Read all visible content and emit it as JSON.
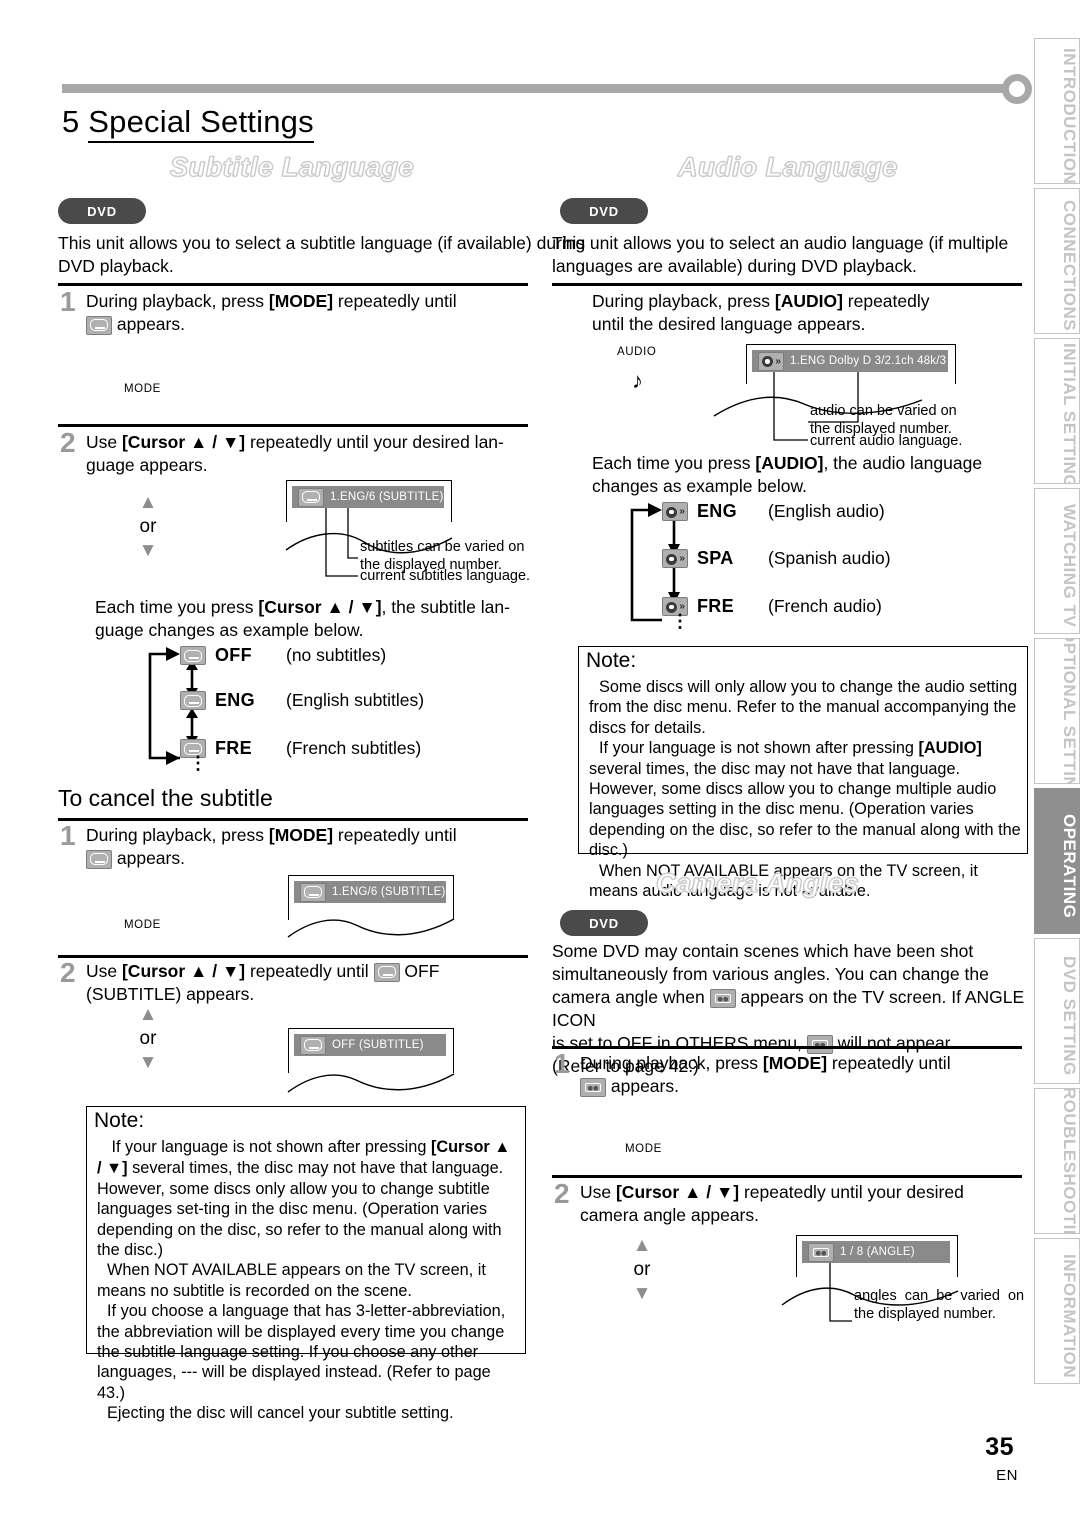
{
  "chapter": {
    "number": "5",
    "title": "Special Settings"
  },
  "sidebar": {
    "tabs": [
      {
        "label": "INTRODUCTION",
        "active": false
      },
      {
        "label": "CONNECTIONS",
        "active": false
      },
      {
        "label": "INITIAL SETTING",
        "active": false
      },
      {
        "label": "WATCHING TV",
        "active": false
      },
      {
        "label": "OPTIONAL SETTING",
        "active": false
      },
      {
        "label": "OPERATING",
        "active": true
      },
      {
        "label": "DVD SETTING",
        "active": false
      },
      {
        "label": "TROUBLESHOOTING",
        "active": false
      },
      {
        "label": "INFORMATION",
        "active": false
      }
    ]
  },
  "subtitle_section": {
    "banner": "Subtitle Language",
    "badge": "DVD",
    "intro": "This unit allows you to select a subtitle language (if available) during DVD playback.",
    "step1": {
      "number": "1",
      "text_before": "During playback, press ",
      "key": "[MODE]",
      "text_after": " repeatedly until",
      "line2": " appears.",
      "mode_label": "MODE"
    },
    "step2": {
      "number": "2",
      "text_before": "Use ",
      "key": "[Cursor ▲ / ▼]",
      "text_after": " repeatedly until your desired lan-",
      "line2": "guage appears.",
      "or_up": "▲",
      "or": "or",
      "or_down": "▼"
    },
    "osd": {
      "icon": "subtitle-icon",
      "text": "1.ENG/6  (SUBTITLE)",
      "callout_top": "subtitles can be varied on\nthe displayed number.",
      "callout_bottom": "current subtitles language."
    },
    "each_time": {
      "text_before": "Each time you press ",
      "key": "[Cursor ▲ / ▼]",
      "text_after": ", the subtitle lan-",
      "line2": "guage changes as example below."
    },
    "cycle": [
      {
        "code": "OFF",
        "desc": "(no subtitles)"
      },
      {
        "code": "ENG",
        "desc": "(English subtitles)"
      },
      {
        "code": "FRE",
        "desc": "(French subtitles)"
      }
    ]
  },
  "cancel_section": {
    "heading": "To cancel the subtitle",
    "step1": {
      "number": "1",
      "text_before": "During playback, press ",
      "key": "[MODE]",
      "text_after": " repeatedly until",
      "line2": " appears.",
      "mode_label": "MODE"
    },
    "step1_osd": {
      "text": "1.ENG/6  (SUBTITLE)"
    },
    "step2": {
      "number": "2",
      "text_before": "Use ",
      "key": "[Cursor ▲ / ▼]",
      "text_mid": " repeatedly until ",
      "text_after": " OFF",
      "line2": "(SUBTITLE)  appears.",
      "or_up": "▲",
      "or": "or",
      "or_down": "▼"
    },
    "step2_osd": {
      "text": "OFF  (SUBTITLE)"
    },
    "note": {
      "title": "Note:",
      "items": [
        "If your language is not shown after pressing [Cursor ▲ / ▼] several times, the disc may not have that language. However, some discs only allow you to change subtitle languages set-ting in the disc menu. (Operation varies depending on the disc, so refer to the manual along with the disc.)",
        "When  NOT AVAILABLE  appears on the TV screen, it means no subtitle is recorded on the scene.",
        "If you choose a language that has 3-letter-abbreviation, the abbreviation will be displayed every time you change the subtitle language setting. If you choose any other languages, ---  will be displayed instead. (Refer to page 43.)",
        "Ejecting the disc will cancel your subtitle setting."
      ]
    }
  },
  "audio_section": {
    "banner": "Audio Language",
    "badge": "DVD",
    "intro": "This unit allows you to select an audio language (if multiple languages are available) during DVD playback.",
    "step1": {
      "text_before": "During playback, press ",
      "key": "[AUDIO]",
      "text_after": " repeatedly",
      "line2": "until the desired language appears.",
      "audio_label": "AUDIO",
      "note_glyph": "♪"
    },
    "osd": {
      "icon": "audio-icon",
      "text": "1.ENG   Dolby D  3/2.1ch  48k/3",
      "callout_top": "audio can be varied on\nthe displayed number.",
      "callout_bottom": "current audio language."
    },
    "each_time": {
      "text_before": "Each time you press ",
      "key": "[AUDIO]",
      "text_after": ", the audio language",
      "line2": "changes as example below."
    },
    "cycle": [
      {
        "code": "ENG",
        "desc": "(English audio)"
      },
      {
        "code": "SPA",
        "desc": "(Spanish audio)"
      },
      {
        "code": "FRE",
        "desc": "(French audio)"
      }
    ],
    "note": {
      "title": "Note:",
      "items": [
        "Some discs will only allow you to change the audio setting from the disc menu. Refer to the manual accompanying the discs for details.",
        "If your language is not shown after pressing [AUDIO] several times, the disc may not have that language. However, some discs allow you to change multiple audio languages setting in the disc menu. (Operation varies depending on the disc, so refer to the manual along with the disc.)",
        "When  NOT AVAILABLE  appears on the TV screen, it means audio language is not available."
      ]
    }
  },
  "angles_section": {
    "banner": "Camera Angles",
    "badge": "DVD",
    "intro_line1": "Some DVD may contain scenes which have been shot",
    "intro_line2": "simultaneously from various angles. You can change the",
    "intro_line3": "camera angle when      appears on the TV screen. If  ANGLE ICON",
    "intro_line4": "is set to  OFF  in  OTHERS  menu,      will not appear.",
    "intro_line5": "(Refer to page 42.)",
    "step1": {
      "number": "1",
      "text_before": "During playback, press ",
      "key": "[MODE]",
      "text_after": " repeatedly until",
      "line2": " appears.",
      "mode_label": "MODE"
    },
    "step2": {
      "number": "2",
      "text_before": "Use ",
      "key": "[Cursor ▲ / ▼]",
      "text_after": " repeatedly until your desired",
      "line2": "camera angle appears.",
      "or_up": "▲",
      "or": "or",
      "or_down": "▼"
    },
    "osd": {
      "icon": "angle-icon",
      "text": "1 / 8  (ANGLE)",
      "callout": "angles  can  be  varied  on\nthe displayed number."
    }
  },
  "footer": {
    "page": "35",
    "lang": "EN"
  }
}
